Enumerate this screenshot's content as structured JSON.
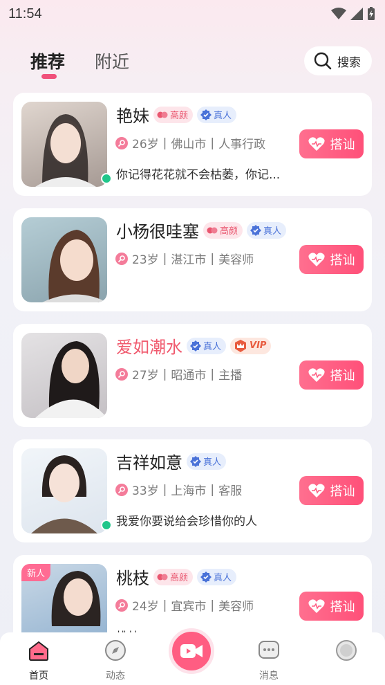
{
  "status_bar": {
    "time": "11:54"
  },
  "header": {
    "tabs": [
      {
        "label": "推荐",
        "active": true
      },
      {
        "label": "附近",
        "active": false
      }
    ],
    "search_label": "搜索"
  },
  "badges": {
    "beauty": "高颜",
    "real": "真人",
    "vip": "VIP",
    "new": "新人"
  },
  "greet_label": "搭讪",
  "profiles": [
    {
      "name": "艳妹",
      "age": "26岁",
      "city": "佛山市",
      "job": "人事行政",
      "bio": "你记得花花就不会枯萎，你记...",
      "avatar_bg": "#cfc3bd"
    },
    {
      "name": "小杨很哇塞",
      "age": "23岁",
      "city": "湛江市",
      "job": "美容师",
      "bio": "",
      "avatar_bg": "#a9c2cc"
    },
    {
      "name": "爱如潮水",
      "age": "27岁",
      "city": "昭通市",
      "job": "主播",
      "bio": "",
      "avatar_bg": "#d8d6d8"
    },
    {
      "name": "吉祥如意",
      "age": "33岁",
      "city": "上海市",
      "job": "客服",
      "bio": "我爱你要说给会珍惜你的人",
      "avatar_bg": "#e8eef4"
    },
    {
      "name": "桃枝",
      "age": "24岁",
      "city": "宜宾市",
      "job": "美容师",
      "bio": "桃枝",
      "avatar_bg": "#b9cde0"
    }
  ],
  "bottom_nav": [
    {
      "label": "首页",
      "active": true
    },
    {
      "label": "动态",
      "active": false
    },
    {
      "label": "消息",
      "active": false
    }
  ],
  "colors": {
    "accent": "#ff5d82",
    "online": "#20c68a"
  }
}
